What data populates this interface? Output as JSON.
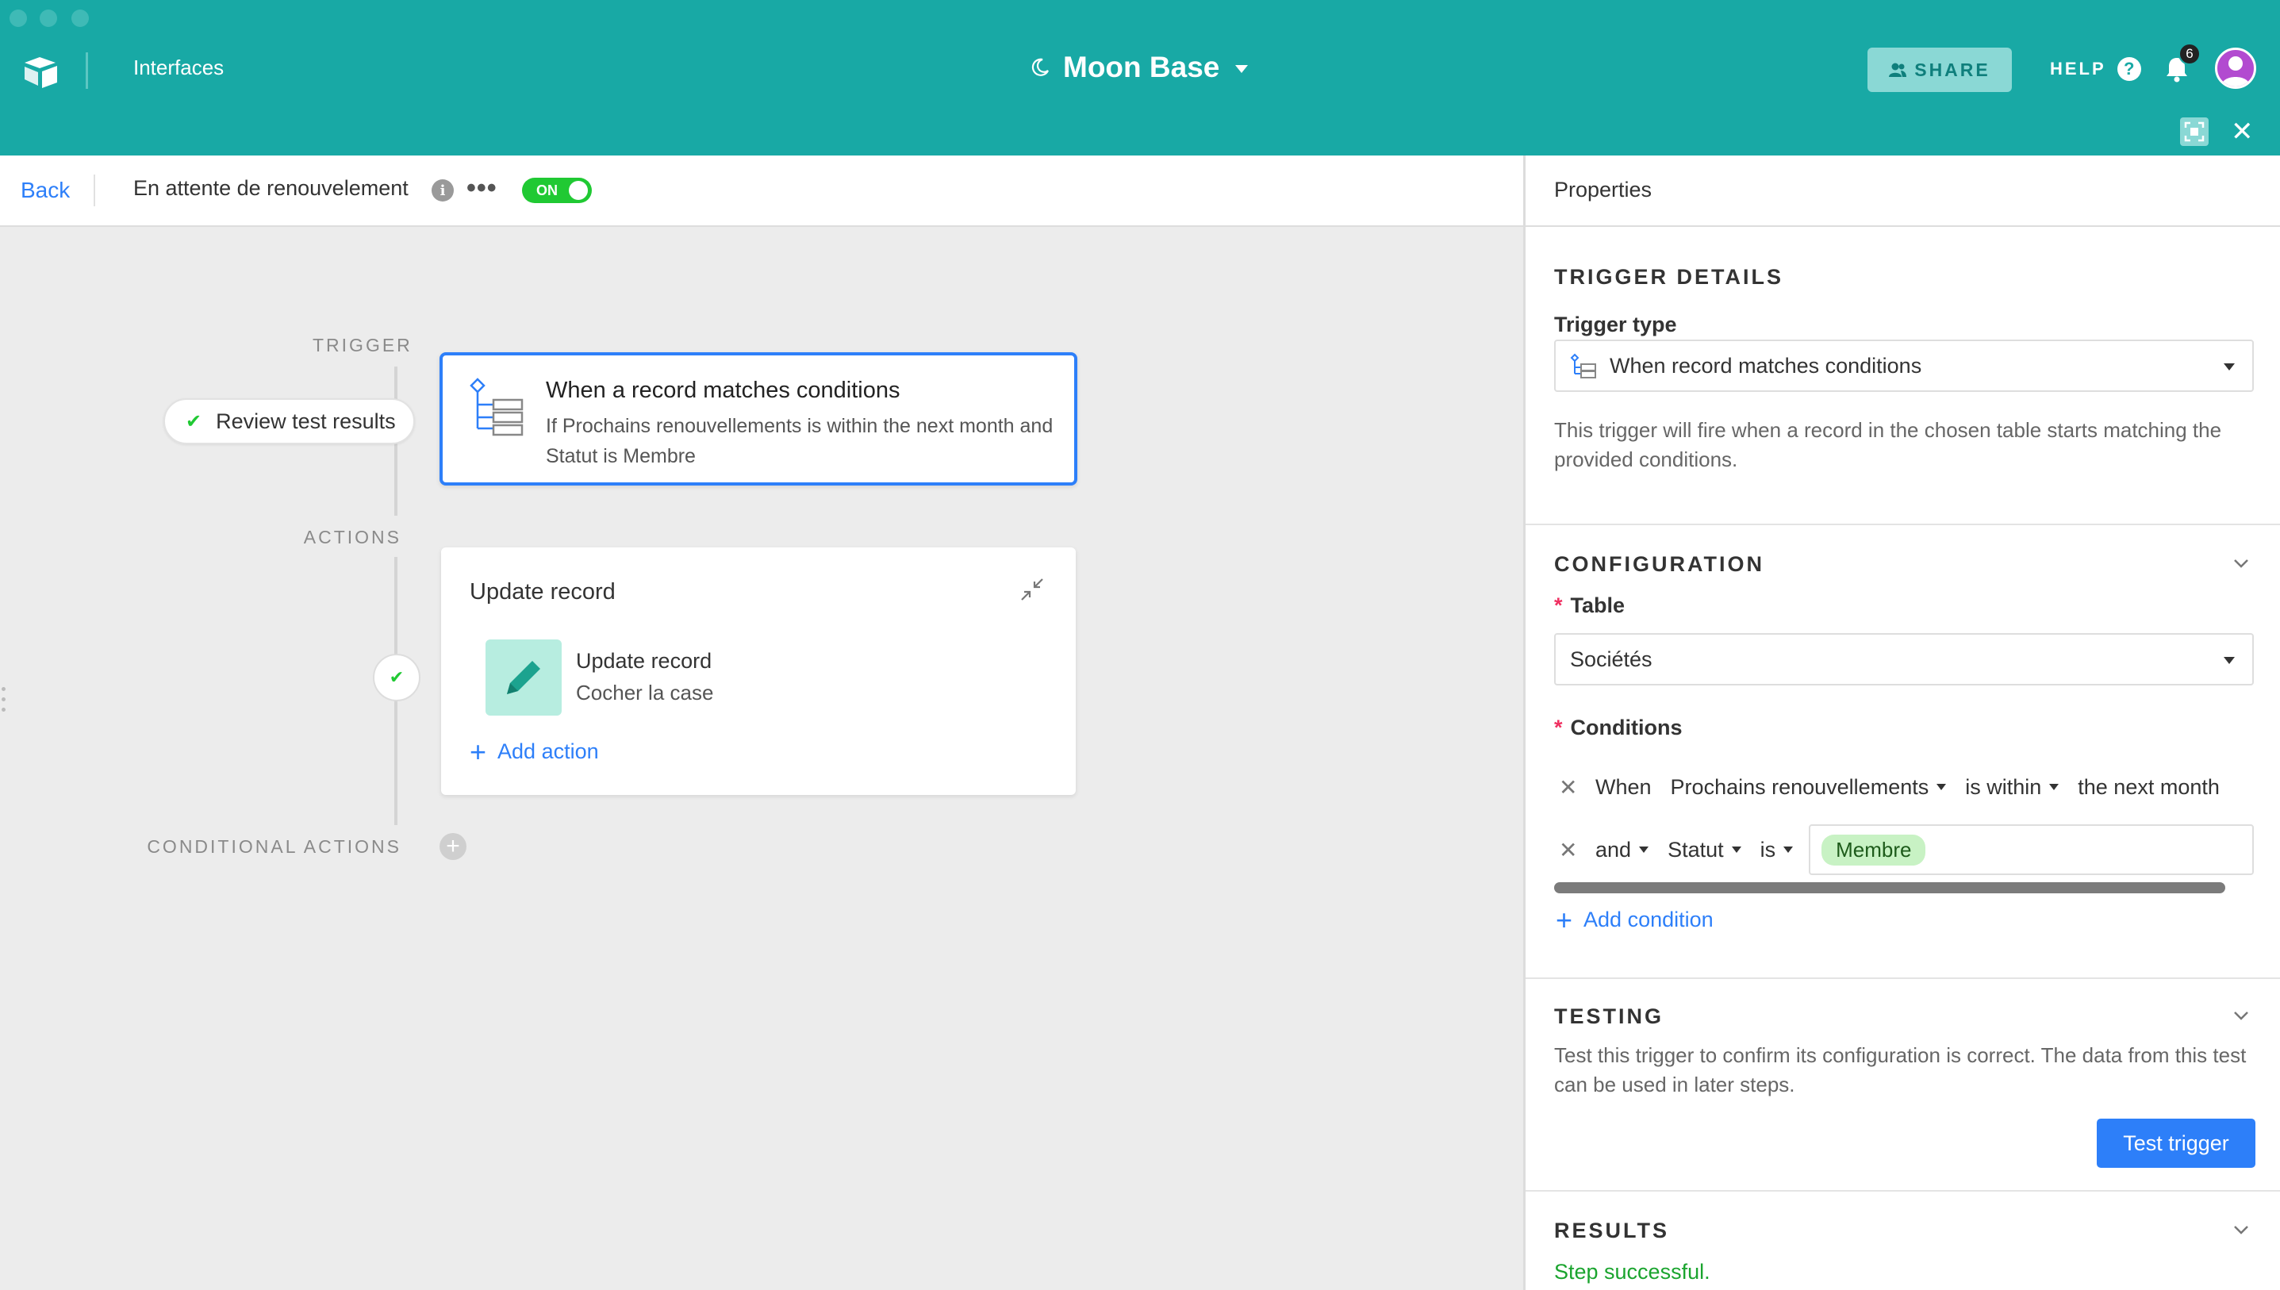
{
  "header": {
    "app_label": "Interfaces",
    "base_name": "Moon Base",
    "share_label": "SHARE",
    "help_label": "HELP",
    "help_glyph": "?",
    "notification_count": "6",
    "close_glyph": "✕",
    "colors": {
      "bar": "#18a9a5",
      "share_bg": "#8ad8d5",
      "avatar": "#b24bd0"
    }
  },
  "toolbar": {
    "back_label": "Back",
    "automation_name": "En attente de renouvelement",
    "info_glyph": "i",
    "more_glyph": "•••",
    "toggle_label": "ON",
    "toggle_on": true
  },
  "canvas": {
    "trigger_label": "TRIGGER",
    "actions_label": "ACTIONS",
    "conditional_label": "CONDITIONAL ACTIONS",
    "review_label": "Review test results",
    "check_glyph": "✔",
    "trigger_card": {
      "title": "When a record matches conditions",
      "description": "If Prochains renouvellements is within the next month and Statut is Membre"
    },
    "action_card": {
      "title": "Update record",
      "step_title": "Update record",
      "step_description": "Cocher la case",
      "add_action_label": "Add action",
      "plus_glyph": "+"
    },
    "conditional_plus_glyph": "+"
  },
  "panel": {
    "title": "Properties",
    "trigger_details": {
      "heading": "TRIGGER DETAILS",
      "trigger_type_label": "Trigger type",
      "trigger_type_value": "When record matches conditions",
      "description": "This trigger will fire when a record in the chosen table starts matching the provided conditions."
    },
    "configuration": {
      "heading": "CONFIGURATION",
      "required_mark": "*",
      "table_label": "Table",
      "table_value": "Sociétés",
      "conditions_label": "Conditions",
      "remove_glyph": "✕",
      "condition_1": {
        "conj": "When",
        "field": "Prochains renouvellements",
        "operator": "is within",
        "value": "the next month"
      },
      "condition_2": {
        "conj": "and",
        "field": "Statut",
        "operator": "is",
        "value": "Membre"
      },
      "add_condition_label": "Add condition",
      "plus_glyph": "+"
    },
    "testing": {
      "heading": "TESTING",
      "description": "Test this trigger to confirm its configuration is correct. The data from this test can be used in later steps.",
      "button_label": "Test trigger"
    },
    "results": {
      "heading": "RESULTS",
      "status": "Step successful."
    }
  }
}
